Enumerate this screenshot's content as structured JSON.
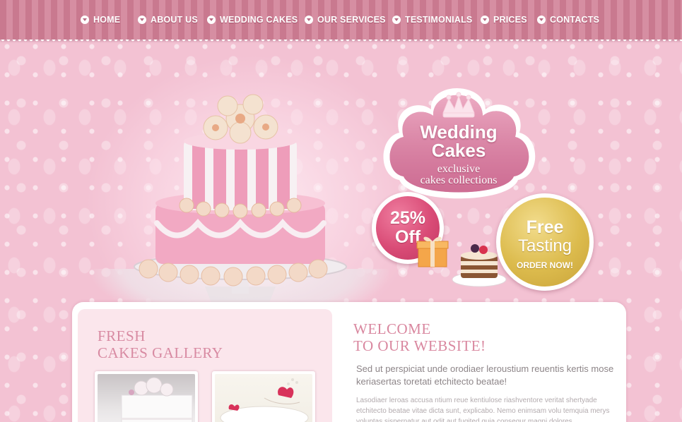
{
  "nav": {
    "items": [
      {
        "label": "HOME"
      },
      {
        "label": "ABOUT US"
      },
      {
        "label": "WEDDING CAKES"
      },
      {
        "label": "OUR SERVICES"
      },
      {
        "label": "TESTIMONIALS"
      },
      {
        "label": "PRICES"
      },
      {
        "label": "CONTACTS"
      }
    ]
  },
  "hero": {
    "cloud_badge": {
      "title_line1": "Wedding",
      "title_line2": "Cakes",
      "sub_line1": "exclusive",
      "sub_line2": "cakes collections",
      "icon": "crown-icon"
    },
    "discount_badge": {
      "percent": "25%",
      "word": "Off"
    },
    "tasting_badge": {
      "line1": "Free",
      "line2": "Tasting",
      "cta": "ORDER NOW!"
    }
  },
  "gallery": {
    "title_line1": "FRESH",
    "title_line2": "CAKES GALLERY"
  },
  "welcome": {
    "title_line1": "WELCOME",
    "title_line2": "TO OUR WEBSITE!",
    "lead": "Sed ut perspiciat unde orodiaer leroustium reuentis kertis mose keriasertas toretati etchitecto beatae!",
    "body": "Lasodiaer leroas accusa ntium reue kentiulose riashventore veritat shertyade etchitecto beatae vitae dicta sunt, explicabo. Nemo enimsam volu temquia merys voluptas sispernatur aut odit aut fugited quia consequr magni dolores"
  },
  "colors": {
    "nav_stripe_dark": "#c9798f",
    "nav_stripe_light": "#d68ea2",
    "hero_pink": "#f3c2d3",
    "heading_pink": "#d9879f",
    "discount_red": "#d94b76",
    "tasting_gold": "#dcbb4d"
  }
}
